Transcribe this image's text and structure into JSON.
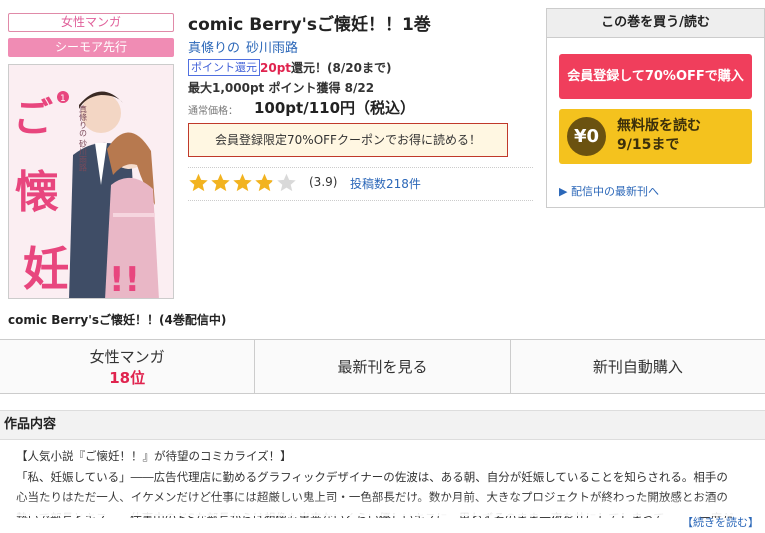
{
  "tags": {
    "genre": "女性マンガ",
    "advance": "シーモア先行"
  },
  "cover": {
    "title_chars": "ご懐妊!!",
    "volume": "1",
    "credit": "真條りの 砂川雨路"
  },
  "book": {
    "title": "comic Berry'sご懐妊！！1巻",
    "authors": [
      "真條りの",
      "砂川雨路"
    ],
    "point_badge": "ポイント還元",
    "point_amount": "20pt",
    "point_rest": "還元！(8/20まで)",
    "max_points": "最大1,000pt ポイント獲得 8/22",
    "price_label": "通常価格：",
    "price": "100pt/110円（税込）",
    "coupon": "会員登録限定70%OFFクーポンでお得に読める！",
    "rating": 3.9,
    "rating_text": "(3.9)",
    "reviews": "投稿数218件"
  },
  "buybox": {
    "heading": "この巻を買う/読む",
    "register_button": "会員登録して70%OFFで購入",
    "free_circle": "¥0",
    "free_line1": "無料版を読む",
    "free_line2": "9/15まで",
    "latest_link": "▶ 配信中の最新刊へ"
  },
  "series": "comic Berry'sご懐妊！！(4巻配信中)",
  "tabs": {
    "ranking_label": "女性マンガ",
    "ranking_value": "18位",
    "latest": "最新刊を見る",
    "auto_buy": "新刊自動購入"
  },
  "section": {
    "heading": "作品内容",
    "lines": [
      "【人気小説『ご懐妊！！』が待望のコミカライズ！】",
      "「私、妊娠している」――広告代理店に勤めるグラフィックデザイナーの佐波は、ある朝、自分が妊娠していることを知らされる。相手の",
      "心当たりはただ一人、イケメンだけど仕事には超厳しい鬼上司・一色部長だけ。数か月前、大きなプロジェクトが終わった開放感とお酒の",
      "勢いで部長とキス――仕事中のドSな部長からは想像も出来ないくらい優しいキスに、思わずそのまま一夜を共にしてしまって……。一度だ"
    ],
    "read_more": "【続きを読む】"
  },
  "colors": {
    "accent_pink": "#f08cb4",
    "buy_red": "#f03e5c",
    "free_yellow": "#f4c21e",
    "link_blue": "#2b67b8",
    "star": "#f2b320"
  }
}
